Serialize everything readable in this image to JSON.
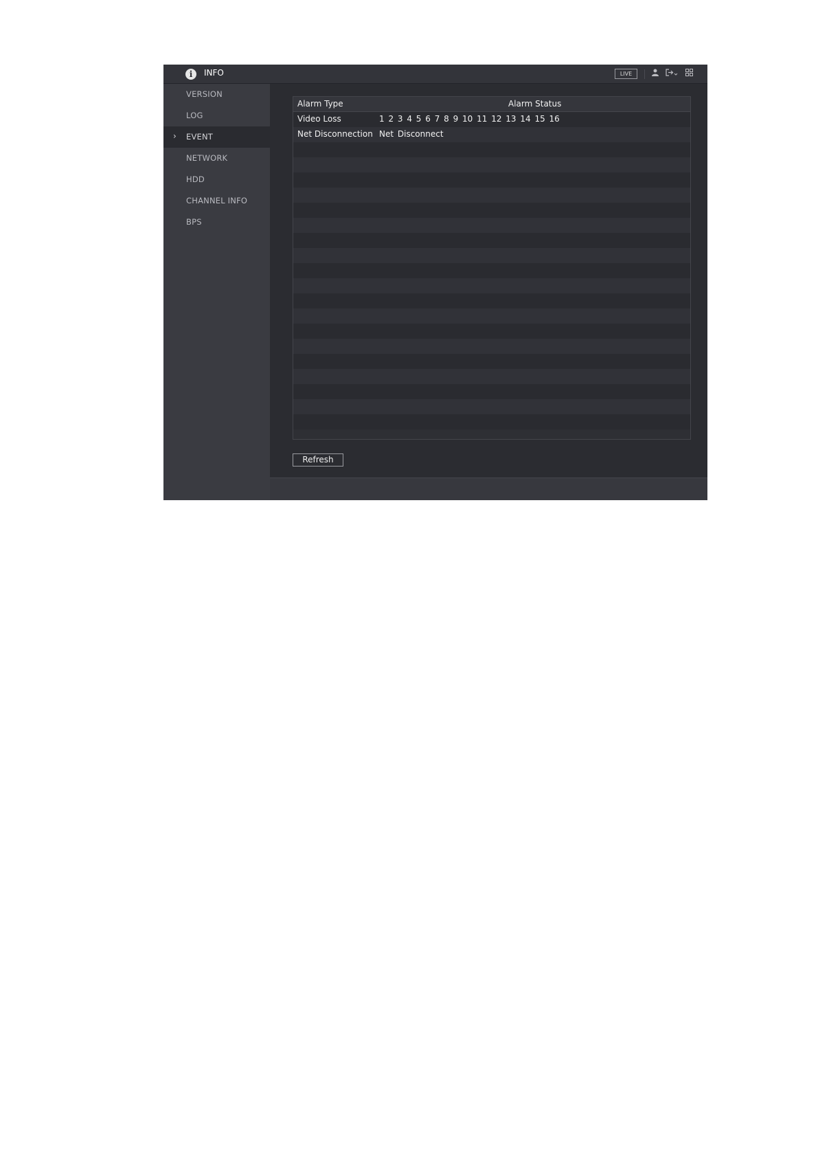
{
  "window": {
    "title": "INFO",
    "live_label": "LIVE",
    "icons": [
      "info-icon",
      "user-icon",
      "logout-icon",
      "menu-icon"
    ]
  },
  "sidebar": {
    "items": [
      {
        "label": "VERSION",
        "active": false
      },
      {
        "label": "LOG",
        "active": false
      },
      {
        "label": "EVENT",
        "active": true
      },
      {
        "label": "NETWORK",
        "active": false
      },
      {
        "label": "HDD",
        "active": false
      },
      {
        "label": "CHANNEL INFO",
        "active": false
      },
      {
        "label": "BPS",
        "active": false
      }
    ]
  },
  "event_table": {
    "columns": [
      "Alarm Type",
      "Alarm Status"
    ],
    "rows": [
      {
        "type": "Video Loss",
        "status": "1 2 3 4 5 6 7 8 9 10 11 12 13 14 15 16"
      },
      {
        "type": "Net Disconnection",
        "status": "Net Disconnect"
      }
    ]
  },
  "actions": {
    "refresh_label": "Refresh"
  },
  "colors": {
    "background": "#2b2c31",
    "sidebar": "#3a3b41",
    "active_item": "#2a2b30"
  }
}
